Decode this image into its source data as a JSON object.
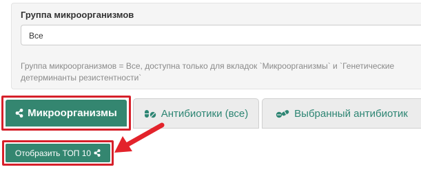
{
  "filter": {
    "label": "Группа микроорганизмов",
    "value": "Все",
    "help": "Группа микроорганизмов = Все, доступна только для вкладок `Микроорганизмы` и `Генетические детерминанты резистентности`"
  },
  "tabs": [
    {
      "label": "Микроорганизмы",
      "icon": "share-icon",
      "active": true
    },
    {
      "label": "Антибиотики (все)",
      "icon": "pills-icon",
      "active": false
    },
    {
      "label": "Выбранный антибиотик",
      "icon": "capsule-icon",
      "active": false
    }
  ],
  "top_button": {
    "label": "Отобразить ТОП 10",
    "icon": "share-icon"
  },
  "colors": {
    "accent": "#348670",
    "highlight": "#d6202a",
    "tab_text": "#2d8573"
  }
}
